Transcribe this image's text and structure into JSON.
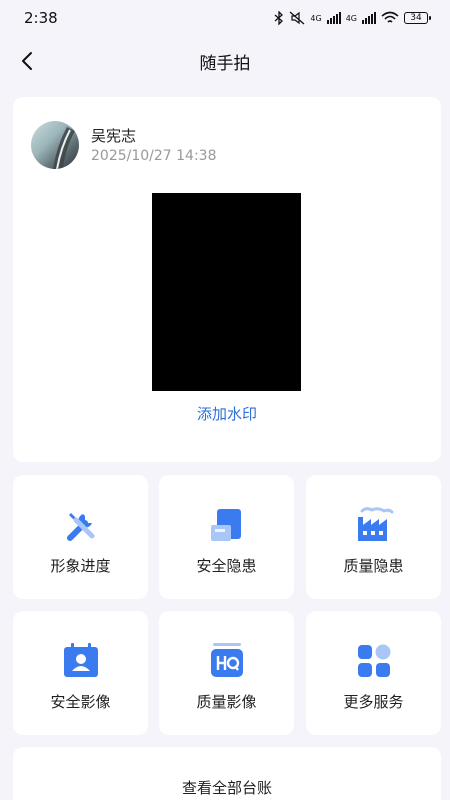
{
  "status_bar": {
    "time": "2:38",
    "network_1": "4G",
    "network_2": "4G",
    "battery": "34"
  },
  "nav": {
    "title": "随手拍"
  },
  "post": {
    "user_name": "吴宪志",
    "timestamp": "2025/10/27 14:38",
    "add_watermark": "添加水印"
  },
  "tiles": [
    {
      "label": "形象进度",
      "icon": "tools-icon"
    },
    {
      "label": "安全隐患",
      "icon": "safety-hazard-icon"
    },
    {
      "label": "质量隐患",
      "icon": "factory-icon"
    },
    {
      "label": "安全影像",
      "icon": "id-card-icon"
    },
    {
      "label": "质量影像",
      "icon": "hq-icon"
    },
    {
      "label": "更多服务",
      "icon": "apps-icon"
    }
  ],
  "ledger": {
    "label": "查看全部台账"
  },
  "colors": {
    "accent": "#2f6fd8",
    "icon_blue": "#3a7bf0",
    "icon_light": "#a9c6f8",
    "background": "#f4f4fa"
  }
}
